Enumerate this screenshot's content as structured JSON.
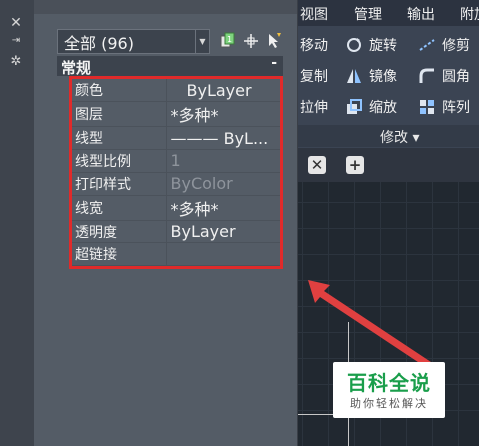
{
  "ribbon": {
    "tabs": [
      "视图",
      "管理",
      "输出",
      "附加"
    ],
    "tools": [
      {
        "label": "移动",
        "icon": "move-icon"
      },
      {
        "label": "旋转",
        "icon": "rotate-icon"
      },
      {
        "label": "修剪",
        "icon": "trim-icon"
      },
      {
        "label": "复制",
        "icon": "copy-icon"
      },
      {
        "label": "镜像",
        "icon": "mirror-icon"
      },
      {
        "label": "圆角",
        "icon": "fillet-icon"
      },
      {
        "label": "拉伸",
        "icon": "stretch-icon"
      },
      {
        "label": "缩放",
        "icon": "scale-icon"
      },
      {
        "label": "阵列",
        "icon": "array-icon"
      }
    ],
    "panel_title": "修改 ▾"
  },
  "drawing_tabs": {
    "close_symbol": "✕",
    "add_symbol": "+"
  },
  "palette": {
    "side_icons": [
      "close-icon",
      "auto-hide-icon",
      "settings-icon"
    ],
    "selection": "全部 (96)",
    "section_title": "常规",
    "section_toggle": "-",
    "properties": [
      {
        "name": "颜色",
        "value": "ByLayer"
      },
      {
        "name": "图层",
        "value": "*多种*"
      },
      {
        "name": "线型",
        "value": "——— ByL..."
      },
      {
        "name": "线型比例",
        "value": "1"
      },
      {
        "name": "打印样式",
        "value": "ByColor"
      },
      {
        "name": "线宽",
        "value": "*多种*"
      },
      {
        "name": "透明度",
        "value": "ByLayer"
      },
      {
        "name": "超链接",
        "value": ""
      }
    ]
  },
  "watermark": {
    "title": "百科全说",
    "subtitle": "助你轻松解决"
  },
  "colors": {
    "highlight": "#e02a2a",
    "arrow": "#e04040",
    "watermark_green": "#1a9e4b"
  }
}
